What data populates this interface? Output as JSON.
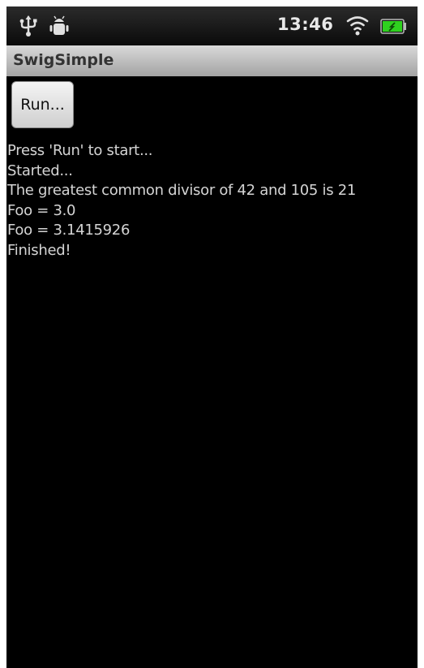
{
  "status_bar": {
    "time": "13:46",
    "icons": [
      "usb-icon",
      "debug-icon",
      "wifi-icon",
      "battery-icon"
    ],
    "battery_color": "#2fd11f"
  },
  "app": {
    "title": "SwigSimple"
  },
  "run_button": {
    "label": "Run..."
  },
  "output": {
    "lines": [
      "Press 'Run' to start...",
      "Started...",
      "The greatest common divisor of 42 and 105 is 21",
      "Foo = 3.0",
      "Foo = 3.1415926",
      "Finished!"
    ]
  }
}
